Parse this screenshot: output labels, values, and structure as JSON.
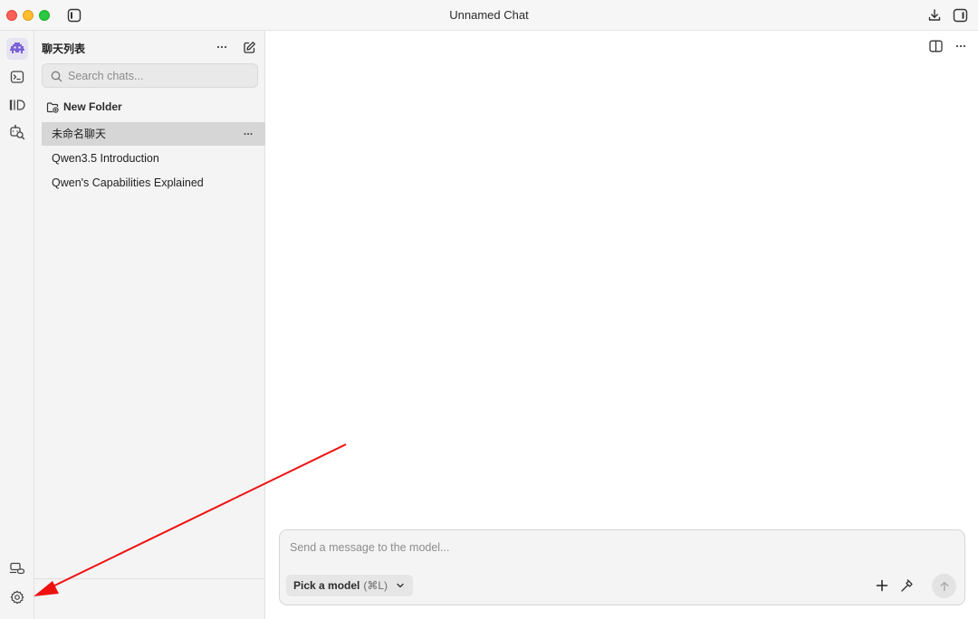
{
  "window": {
    "title": "Unnamed Chat"
  },
  "sidebar": {
    "title": "聊天列表",
    "search_placeholder": "Search chats...",
    "new_folder_label": "New Folder",
    "chats": [
      {
        "label": "未命名聊天",
        "active": true
      },
      {
        "label": "Qwen3.5 Introduction",
        "active": false
      },
      {
        "label": "Qwen's Capabilities Explained",
        "active": false
      }
    ]
  },
  "rail": {
    "items": [
      "app-logo-icon",
      "terminal-icon",
      "library-icon",
      "model-search-icon"
    ],
    "bottom_items": [
      "devices-icon",
      "settings-icon"
    ]
  },
  "composer": {
    "placeholder": "Send a message to the model...",
    "model_picker_label": "Pick a model",
    "model_picker_shortcut": "(⌘L)"
  },
  "colors": {
    "accent": "#7b61d6",
    "annotation_arrow": "#ee1111",
    "active_chat_bg": "#d6d6d6"
  }
}
